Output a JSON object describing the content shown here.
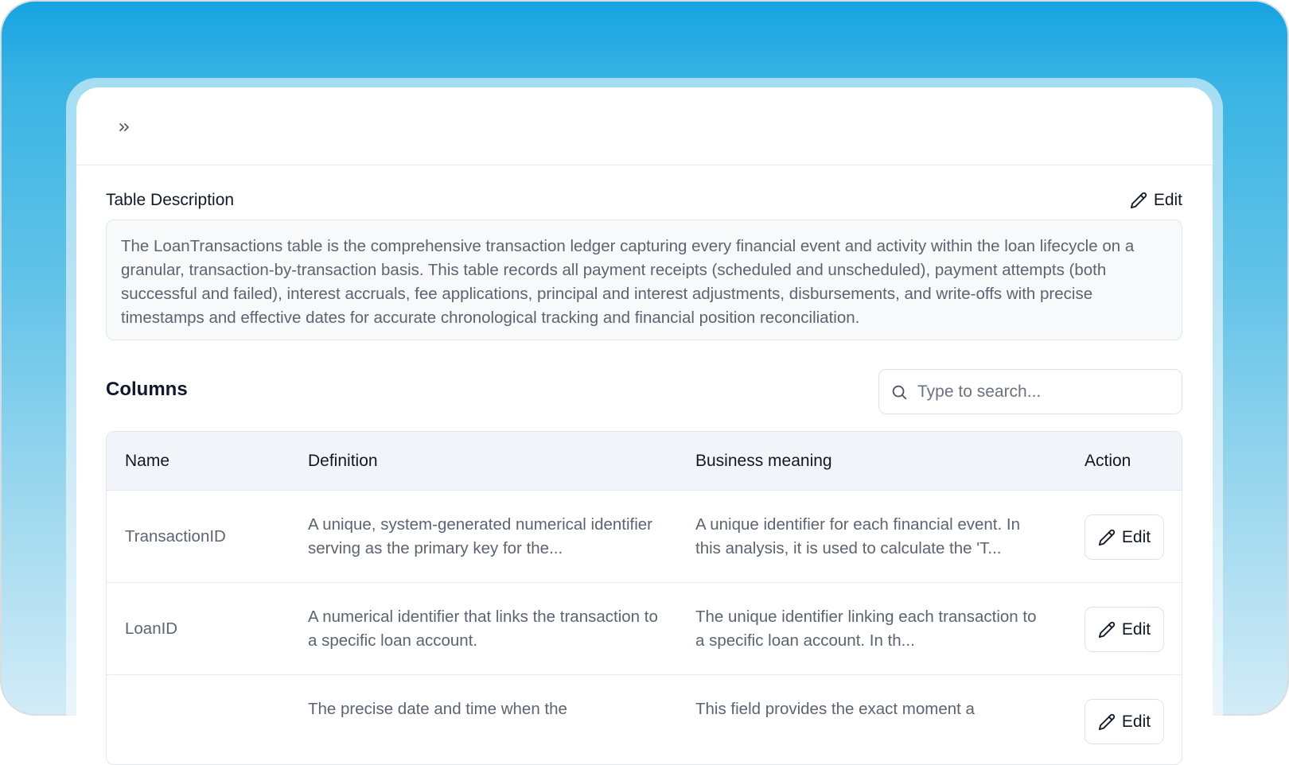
{
  "description": {
    "title": "Table Description",
    "edit_label": "Edit",
    "text": "The LoanTransactions table is the comprehensive transaction ledger capturing every financial event and activity within the loan lifecycle on a granular, transaction-by-transaction basis. This table records all payment receipts (scheduled and unscheduled), payment attempts (both successful and failed), interest accruals, fee applications, principal and interest adjustments, disbursements, and write-offs with precise timestamps and effective dates for accurate chronological tracking and financial position reconciliation."
  },
  "columns_section": {
    "title": "Columns",
    "search_placeholder": "Type to search..."
  },
  "table": {
    "headers": {
      "name": "Name",
      "definition": "Definition",
      "business": "Business meaning",
      "action": "Action"
    },
    "rows": [
      {
        "name": "TransactionID",
        "definition": "A unique, system-generated numerical identifier serving as the primary key for the...",
        "business": "A unique identifier for each financial event. In this analysis, it is used to calculate the 'T...",
        "action": "Edit"
      },
      {
        "name": "LoanID",
        "definition": "A numerical identifier that links the transaction to a specific loan account.",
        "business": "The unique identifier linking each transaction to a specific loan account. In th...",
        "action": "Edit"
      },
      {
        "name": "",
        "definition": "The precise date and time when the",
        "business": "This field provides the exact moment a",
        "action": "Edit"
      }
    ]
  },
  "icons": {
    "expand": "chevrons-right-icon",
    "edit": "pencil-icon",
    "search": "search-icon"
  }
}
